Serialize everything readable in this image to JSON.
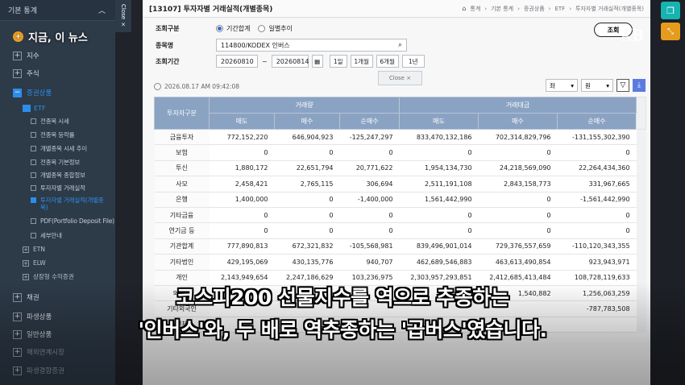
{
  "sidebar": {
    "header": "기본 통계",
    "header_icon": "chevron-up-icon",
    "items": [
      {
        "label": "지수",
        "icon": "plus"
      },
      {
        "label": "주식",
        "icon": "plus"
      },
      {
        "label": "증권상품",
        "icon": "minus"
      }
    ],
    "etf": "ETF",
    "etf_children": [
      "전종목 시세",
      "전종목 등락률",
      "개별종목 시세 추이",
      "전종목 기본정보",
      "개별종목 종합정보",
      "투자자별 거래실적",
      "투자자별 거래실적(개별종목)",
      "PDF(Portfolio Deposit File)",
      "세부안내"
    ],
    "other_products": [
      "ETN",
      "ELW",
      "상장형 수익증권"
    ],
    "bottom_items": [
      "채권",
      "파생상품",
      "일반상품",
      "해외연계시장",
      "파생결합증권"
    ]
  },
  "news_tag": "지금, 이 뉴스",
  "close_tab": "Close ×",
  "page": {
    "title": "[13107] 투자자별 거래실적(개별종목)",
    "breadcrumb": [
      "통계",
      "기본 통계",
      "증권상품",
      "ETF",
      "투자자별 거래실적(개별종목)"
    ]
  },
  "form": {
    "query_type_label": "조회구분",
    "query_type_options": [
      "기간합계",
      "일별추이"
    ],
    "ticker_label": "종목명",
    "ticker_value": "114800/KODEX 인버스",
    "period_label": "조회기간",
    "date_from": "20260810",
    "date_sep": "~",
    "date_to": "20260814",
    "period_buttons": [
      "1일",
      "1개월",
      "6개월",
      "1년"
    ],
    "query_button": "조회"
  },
  "close_popup": "Close ×",
  "timestamp": "2026.08.17 AM 09:42:08",
  "controls": {
    "sort": "좌",
    "unit": "원"
  },
  "table": {
    "col_investor": "투자자구분",
    "group_volume": "거래량",
    "group_value": "거래대금",
    "sub_headers": [
      "매도",
      "매수",
      "순매수",
      "매도",
      "매수",
      "순매수"
    ],
    "rows": [
      {
        "label": "금융투자",
        "vals": [
          "772,152,220",
          "646,904,923",
          "-125,247,297",
          "833,470,132,186",
          "702,314,829,796",
          "-131,155,302,390"
        ]
      },
      {
        "label": "보험",
        "vals": [
          "0",
          "0",
          "0",
          "0",
          "0",
          "0"
        ]
      },
      {
        "label": "투신",
        "vals": [
          "1,880,172",
          "22,651,794",
          "20,771,622",
          "1,954,134,730",
          "24,218,569,090",
          "22,264,434,360"
        ]
      },
      {
        "label": "사모",
        "vals": [
          "2,458,421",
          "2,765,115",
          "306,694",
          "2,511,191,108",
          "2,843,158,773",
          "331,967,665"
        ]
      },
      {
        "label": "은행",
        "vals": [
          "1,400,000",
          "0",
          "-1,400,000",
          "1,561,442,990",
          "0",
          "-1,561,442,990"
        ]
      },
      {
        "label": "기타금융",
        "vals": [
          "0",
          "0",
          "0",
          "0",
          "0",
          "0"
        ]
      },
      {
        "label": "연기금 등",
        "vals": [
          "0",
          "0",
          "0",
          "0",
          "0",
          "0"
        ]
      },
      {
        "label": "기관합계",
        "vals": [
          "777,890,813",
          "672,321,832",
          "-105,568,981",
          "839,496,901,014",
          "729,376,557,659",
          "-110,120,343,355"
        ]
      },
      {
        "label": "기타법인",
        "vals": [
          "429,195,069",
          "430,135,776",
          "940,707",
          "462,689,546,883",
          "463,613,490,854",
          "923,943,971"
        ]
      },
      {
        "label": "개인",
        "vals": [
          "2,143,949,654",
          "2,247,186,629",
          "103,236,975",
          "2,303,957,293,851",
          "2,412,685,413,484",
          "108,728,119,633"
        ]
      },
      {
        "label": "외국인",
        "vals": [
          "",
          "",
          "",
          "",
          "1,540,882",
          "1,256,063,259"
        ]
      },
      {
        "label": "기타외국인",
        "vals": [
          "",
          "",
          "",
          "",
          "",
          "-787,783,508"
        ]
      },
      {
        "label": "전체",
        "vals": [
          "",
          "",
          "",
          "",
          "",
          ""
        ]
      }
    ]
  },
  "subtitle": {
    "line1": "코스피200 선물지수를 역으로 추종하는",
    "line2": "'인버스'와, 두 배로 역추종하는 '곱버스'였습니다."
  },
  "logo_ghost": "KB"
}
